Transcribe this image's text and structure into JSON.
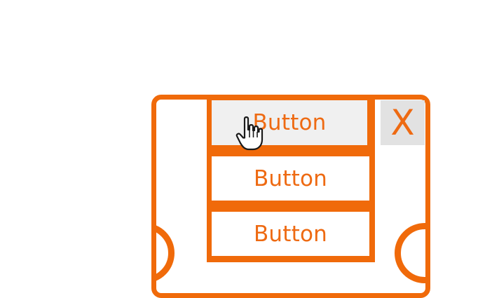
{
  "dialog": {
    "close_label": "X",
    "buttons": [
      {
        "label": "Button",
        "state": "hovered"
      },
      {
        "label": "Button",
        "state": "normal"
      },
      {
        "label": "Button",
        "state": "normal"
      }
    ]
  },
  "colors": {
    "accent": "#f06a0a",
    "button_text": "#ee6a12",
    "hover_background": "#f0f0f0",
    "close_background": "#e2e2e2",
    "page_background": "#ffffff"
  },
  "icons": {
    "cursor": "hand-pointer-icon",
    "decorations": "ring-icon"
  }
}
